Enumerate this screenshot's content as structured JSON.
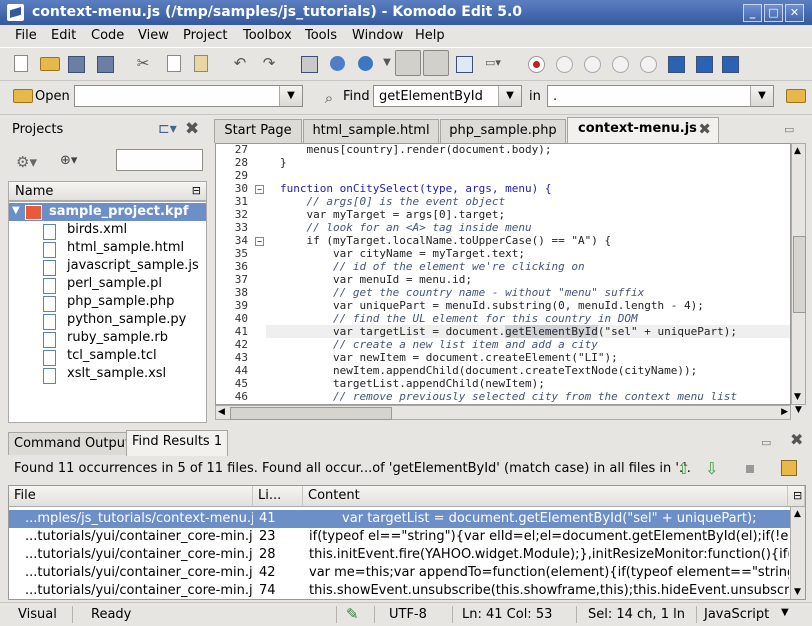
{
  "window": {
    "title": "context-menu.js (/tmp/samples/js_tutorials) - Komodo Edit 5.0",
    "min": "_",
    "max": "□",
    "close": "✕"
  },
  "menu": [
    "File",
    "Edit",
    "Code",
    "View",
    "Project",
    "Toolbox",
    "Tools",
    "Window",
    "Help"
  ],
  "toolbar2": {
    "open_label": "Open",
    "open_value": "",
    "find_label": "Find",
    "find_value": "getElementById",
    "in_label": "in",
    "in_value": "."
  },
  "projects": {
    "title": "Projects",
    "column": "Name",
    "root": "sample_project.kpf",
    "files": [
      "birds.xml",
      "html_sample.html",
      "javascript_sample.js",
      "perl_sample.pl",
      "php_sample.php",
      "python_sample.py",
      "ruby_sample.rb",
      "tcl_sample.tcl",
      "xslt_sample.xsl"
    ]
  },
  "editor": {
    "tabs": [
      "Start Page",
      "html_sample.html",
      "php_sample.php",
      "context-menu.js"
    ],
    "lines": [
      {
        "n": "27",
        "t": "    menus[country].render(document.body);",
        "c": "code"
      },
      {
        "n": "28",
        "t": "}",
        "c": "code"
      },
      {
        "n": "29",
        "t": "",
        "c": "code"
      },
      {
        "n": "30",
        "t": "function onCitySelect(type, args, menu) {",
        "c": "kw"
      },
      {
        "n": "31",
        "t": "    // args[0] is the event object",
        "c": "cm"
      },
      {
        "n": "32",
        "t": "    var myTarget = args[0].target;",
        "c": "code"
      },
      {
        "n": "33",
        "t": "    // look for an <A> tag inside menu",
        "c": "cm"
      },
      {
        "n": "34",
        "t": "    if (myTarget.localName.toUpperCase() == \"A\") {",
        "c": "code"
      },
      {
        "n": "35",
        "t": "        var cityName = myTarget.text;",
        "c": "code"
      },
      {
        "n": "36",
        "t": "        // id of the element we're clicking on",
        "c": "cm"
      },
      {
        "n": "37",
        "t": "        var menuId = menu.id;",
        "c": "code"
      },
      {
        "n": "38",
        "t": "        // get the country name - without \"menu\" suffix",
        "c": "cm"
      },
      {
        "n": "39",
        "t": "        var uniquePart = menuId.substring(0, menuId.length - 4);",
        "c": "code"
      },
      {
        "n": "40",
        "t": "        // find the UL element for this country in DOM",
        "c": "cm"
      },
      {
        "n": "41",
        "t": "        var targetList = document.getElementById(\"sel\" + uniquePart);",
        "c": "cur"
      },
      {
        "n": "42",
        "t": "        // create a new list item and add a city",
        "c": "cm"
      },
      {
        "n": "43",
        "t": "        var newItem = document.createElement(\"LI\");",
        "c": "code"
      },
      {
        "n": "44",
        "t": "        newItem.appendChild(document.createTextNode(cityName));",
        "c": "code"
      },
      {
        "n": "45",
        "t": "        targetList.appendChild(newItem);",
        "c": "code"
      },
      {
        "n": "46",
        "t": "        // remove previously selected city from the context menu list",
        "c": "cm"
      }
    ]
  },
  "bottom": {
    "tabs": [
      "Command Output",
      "Find Results 1"
    ],
    "found": "Found 11 occurrences in 5 of 11 files. Found all occur...of 'getElementById' (match case) in all files in '.'.",
    "columns": [
      "File",
      "Li...",
      "Content"
    ],
    "rows": [
      {
        "file": "...mples/js_tutorials/context-menu.js",
        "line": "41",
        "content": "        var targetList = document.getElementById(\"sel\" + uniquePart);"
      },
      {
        "file": "...tutorials/yui/container_core-min.js",
        "line": "23",
        "content": "if(typeof el==\"string\"){var elId=el;el=document.getElementById(el);if(!el){"
      },
      {
        "file": "...tutorials/yui/container_core-min.js",
        "line": "28",
        "content": "this.initEvent.fire(YAHOO.widget.Module);},initResizeMonitor:function(){if(th"
      },
      {
        "file": "...tutorials/yui/container_core-min.js",
        "line": "42",
        "content": "var me=this;var appendTo=function(element){if(typeof element==\"string\"..."
      },
      {
        "file": "...tutorials/yui/container_core-min.js",
        "line": "74",
        "content": "this.showEvent.unsubscribe(this.showframe,this);this.hideEvent.unsubscri..."
      }
    ]
  },
  "status": {
    "mode": "Visual",
    "state": "Ready",
    "encoding": "UTF-8",
    "position": "Ln: 41 Col: 53",
    "selection": "Sel: 14 ch, 1 ln",
    "language": "JavaScript"
  },
  "colors": {
    "titlebar": "#35599f",
    "selection": "#6d8fc8",
    "keyword": "#2222aa"
  }
}
